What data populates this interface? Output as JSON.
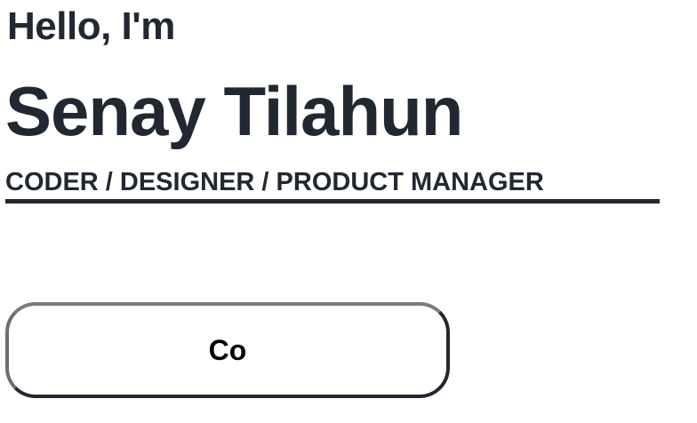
{
  "hero": {
    "greeting": "Hello, I'm",
    "name": "Senay Tilahun",
    "roles": "CODER / DESIGNER / PRODUCT MANAGER"
  },
  "cta": {
    "label": "Co"
  },
  "colors": {
    "text": "#222831",
    "background": "#ffffff",
    "button_border": "#222831"
  }
}
